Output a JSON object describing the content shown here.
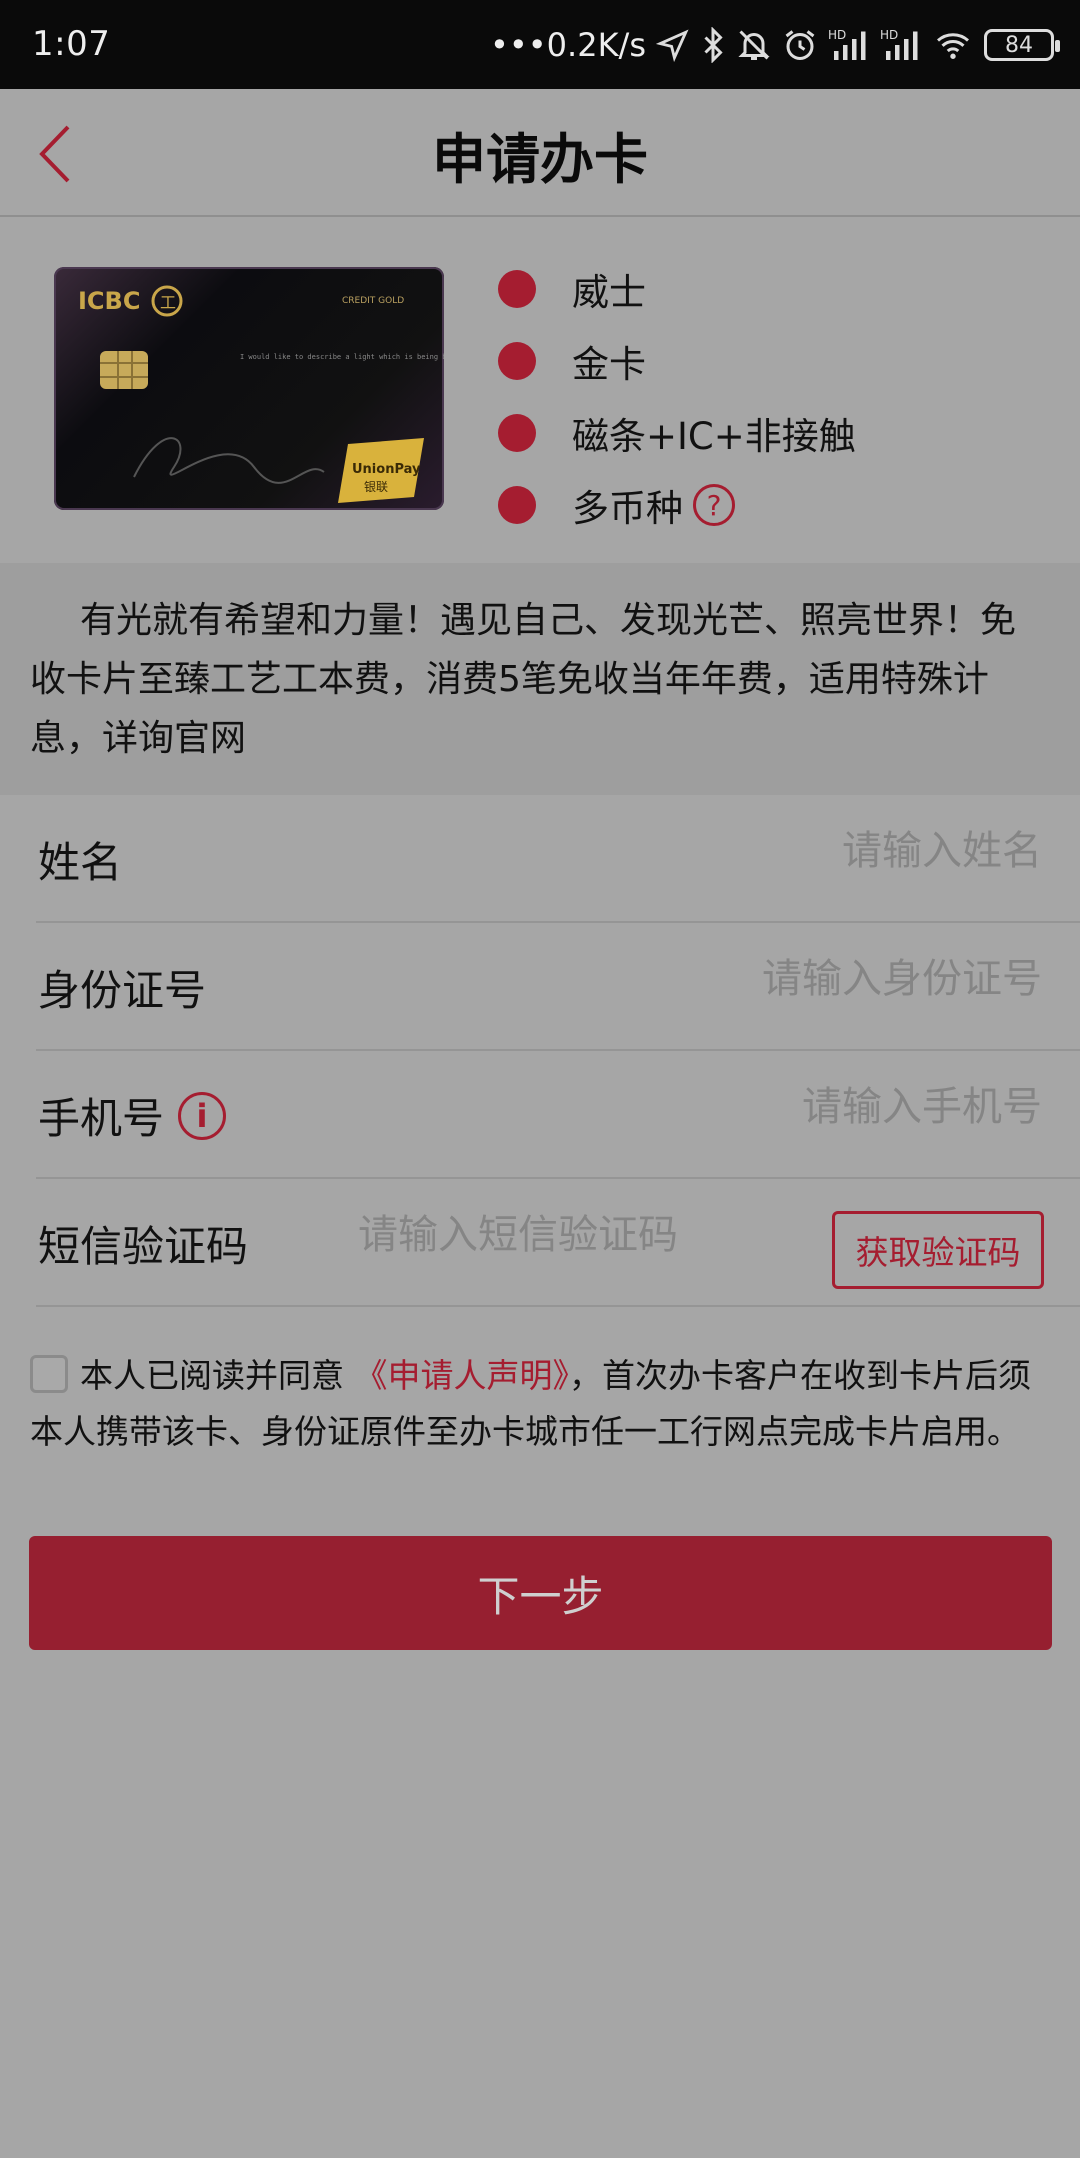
{
  "status_bar": {
    "time": "1:07",
    "net_speed": "•••0.2K/s",
    "signal1_label": "HD",
    "signal2_label": "HD",
    "battery": "84",
    "icons": [
      "location-icon",
      "bluetooth-icon",
      "mute-icon",
      "alarm-icon",
      "signal-icon",
      "signal-icon",
      "wifi-icon",
      "battery-icon"
    ]
  },
  "header": {
    "title": "申请办卡",
    "back_icon": "chevron-left-icon"
  },
  "card": {
    "brand": "ICBC",
    "brand_logo_char": "工",
    "tier_text": "CREDIT GOLD",
    "card_message": "I would like to describe a light which is being born to me",
    "network": "UnionPay",
    "network_cn": "银联",
    "features": [
      "威士",
      "金卡",
      "磁条+IC+非接触",
      "多币种"
    ],
    "help_symbol": "?"
  },
  "description": "有光就有希望和力量！遇见自己、发现光芒、照亮世界！免收卡片至臻工艺工本费，消费5笔免收当年年费，适用特殊计息，详询官网",
  "form": {
    "name_label": "姓名",
    "name_placeholder": "请输入姓名",
    "id_label": "身份证号",
    "id_placeholder": "请输入身份证号",
    "phone_label": "手机号",
    "phone_info_symbol": "i",
    "phone_placeholder": "请输入手机号",
    "sms_label": "短信验证码",
    "sms_placeholder": "请输入短信验证码",
    "sms_button": "获取验证码"
  },
  "agreement": {
    "prefix": "本人已阅读并同意",
    "link": "《申请人声明》",
    "suffix": "，首次办卡客户在收到卡片后须本人携带该卡、身份证原件至办卡城市任一工行网点完成卡片启用。"
  },
  "next_button": "下一步",
  "colors": {
    "accent": "#a51d30",
    "overlay_bg": "#a6a6a6",
    "status_bar": "#0a0a0a"
  }
}
